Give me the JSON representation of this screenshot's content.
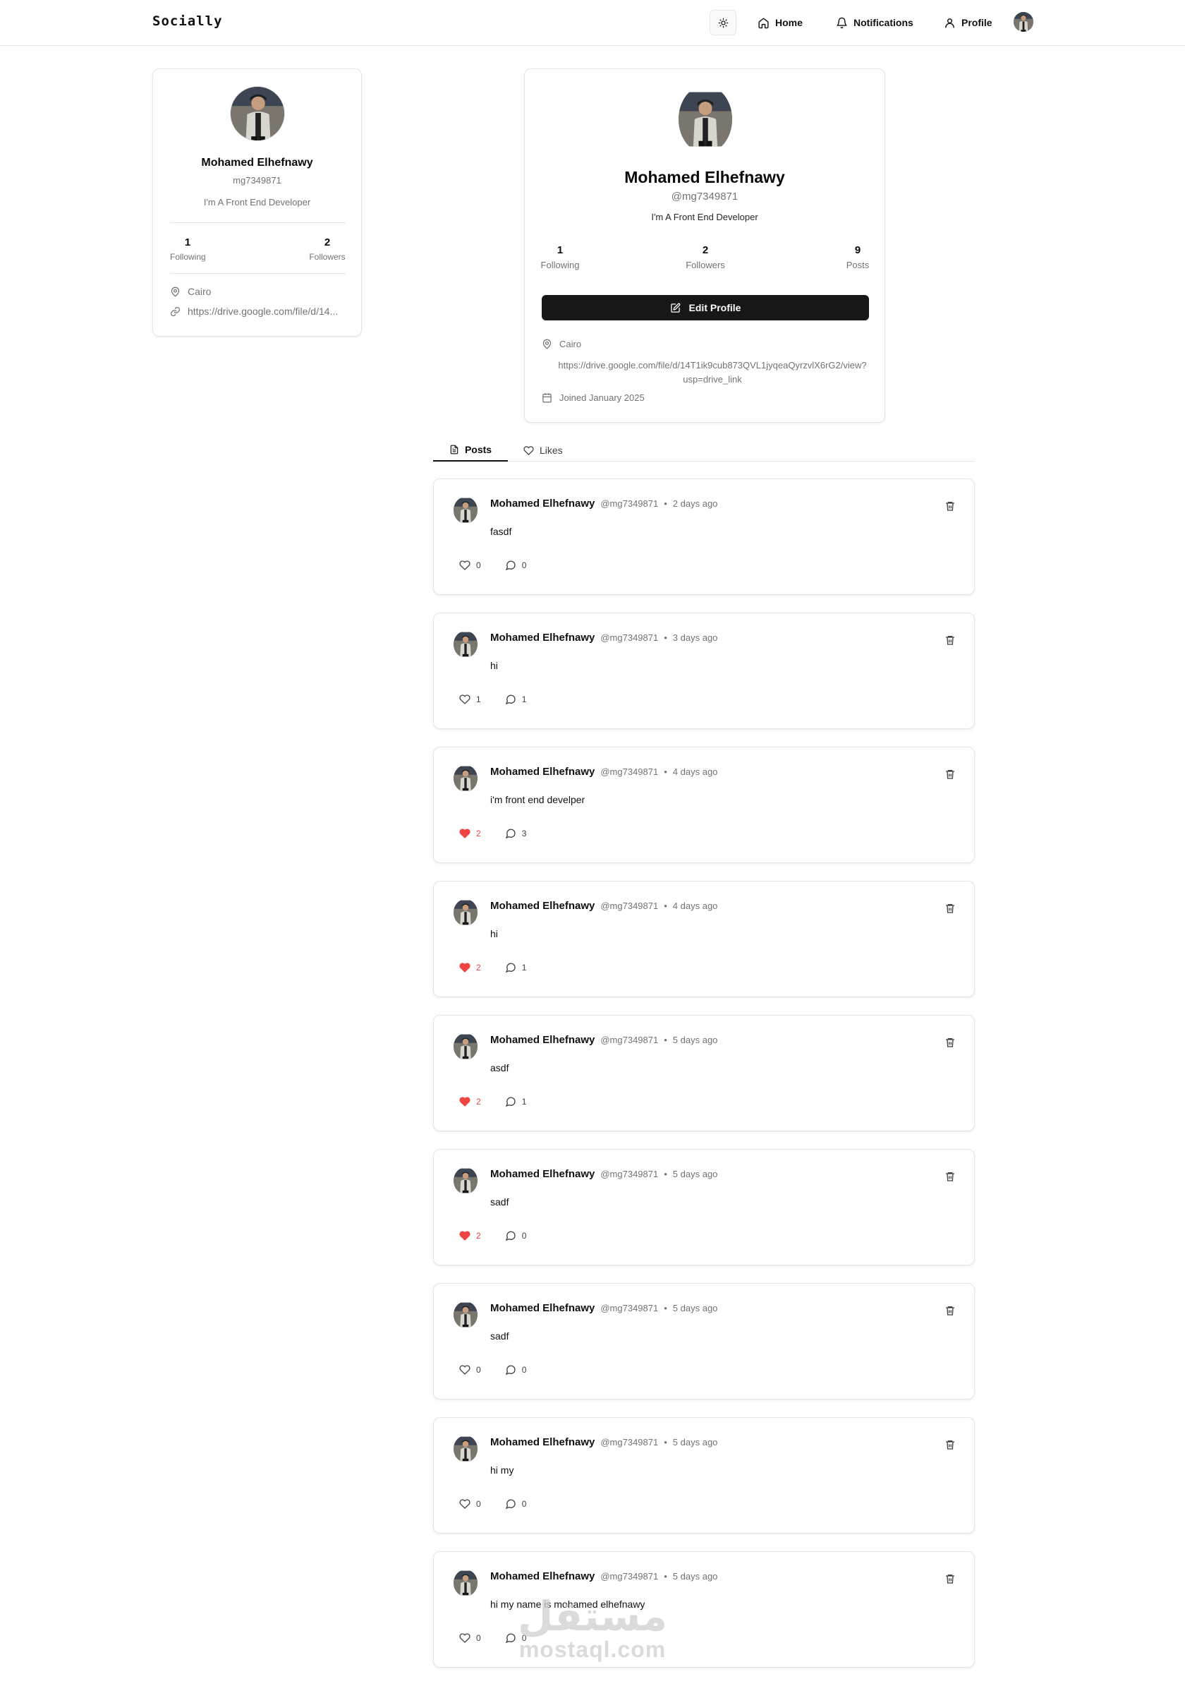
{
  "app": {
    "name": "Socially"
  },
  "nav": {
    "home": "Home",
    "notifications": "Notifications",
    "profile": "Profile"
  },
  "sidebar": {
    "name": "Mohamed Elhefnawy",
    "username": "mg7349871",
    "bio": "I'm A Front End Developer",
    "following_count": "1",
    "following_label": "Following",
    "followers_count": "2",
    "followers_label": "Followers",
    "location": "Cairo",
    "website": "https://drive.google.com/file/d/14..."
  },
  "profile": {
    "name": "Mohamed Elhefnawy",
    "handle": "@mg7349871",
    "bio": "I'm A Front End Developer",
    "following_count": "1",
    "following_label": "Following",
    "followers_count": "2",
    "followers_label": "Followers",
    "posts_count": "9",
    "posts_label": "Posts",
    "edit_label": "Edit Profile",
    "location": "Cairo",
    "website_line1": "https://drive.google.com/file/d/14T1ik9cub873QVL1jyqeaQyrzvlX6rG2/view?",
    "website_line2": "usp=drive_link",
    "joined": "Joined January 2025"
  },
  "tabs": {
    "posts": "Posts",
    "likes": "Likes"
  },
  "posts": [
    {
      "author": "Mohamed Elhefnawy",
      "handle": "@mg7349871",
      "sep": "•",
      "time": "2 days ago",
      "content": "fasdf",
      "likes": "0",
      "comments": "0",
      "liked": false
    },
    {
      "author": "Mohamed Elhefnawy",
      "handle": "@mg7349871",
      "sep": "•",
      "time": "3 days ago",
      "content": "hi",
      "likes": "1",
      "comments": "1",
      "liked": false
    },
    {
      "author": "Mohamed Elhefnawy",
      "handle": "@mg7349871",
      "sep": "•",
      "time": "4 days ago",
      "content": "i'm front end develper",
      "likes": "2",
      "comments": "3",
      "liked": true
    },
    {
      "author": "Mohamed Elhefnawy",
      "handle": "@mg7349871",
      "sep": "•",
      "time": "4 days ago",
      "content": "hi",
      "likes": "2",
      "comments": "1",
      "liked": true
    },
    {
      "author": "Mohamed Elhefnawy",
      "handle": "@mg7349871",
      "sep": "•",
      "time": "5 days ago",
      "content": "asdf",
      "likes": "2",
      "comments": "1",
      "liked": true
    },
    {
      "author": "Mohamed Elhefnawy",
      "handle": "@mg7349871",
      "sep": "•",
      "time": "5 days ago",
      "content": "sadf",
      "likes": "2",
      "comments": "0",
      "liked": true
    },
    {
      "author": "Mohamed Elhefnawy",
      "handle": "@mg7349871",
      "sep": "•",
      "time": "5 days ago",
      "content": "sadf",
      "likes": "0",
      "comments": "0",
      "liked": false
    },
    {
      "author": "Mohamed Elhefnawy",
      "handle": "@mg7349871",
      "sep": "•",
      "time": "5 days ago",
      "content": "hi my",
      "likes": "0",
      "comments": "0",
      "liked": false
    },
    {
      "author": "Mohamed Elhefnawy",
      "handle": "@mg7349871",
      "sep": "•",
      "time": "5 days ago",
      "content": "hi my name is mohamed elhefnawy",
      "likes": "0",
      "comments": "0",
      "liked": false
    }
  ],
  "watermark": {
    "arabic": "مستقل",
    "latin": "mostaql.com"
  },
  "colors": {
    "accent": "#171717",
    "liked": "#ef4444",
    "muted": "#737373",
    "border": "#e5e5e5"
  },
  "icons": [
    "sun-icon",
    "home-icon",
    "bell-icon",
    "user-icon",
    "map-pin-icon",
    "link-icon",
    "calendar-icon",
    "edit-icon",
    "file-text-icon",
    "heart-icon",
    "message-circle-icon",
    "trash-icon"
  ]
}
